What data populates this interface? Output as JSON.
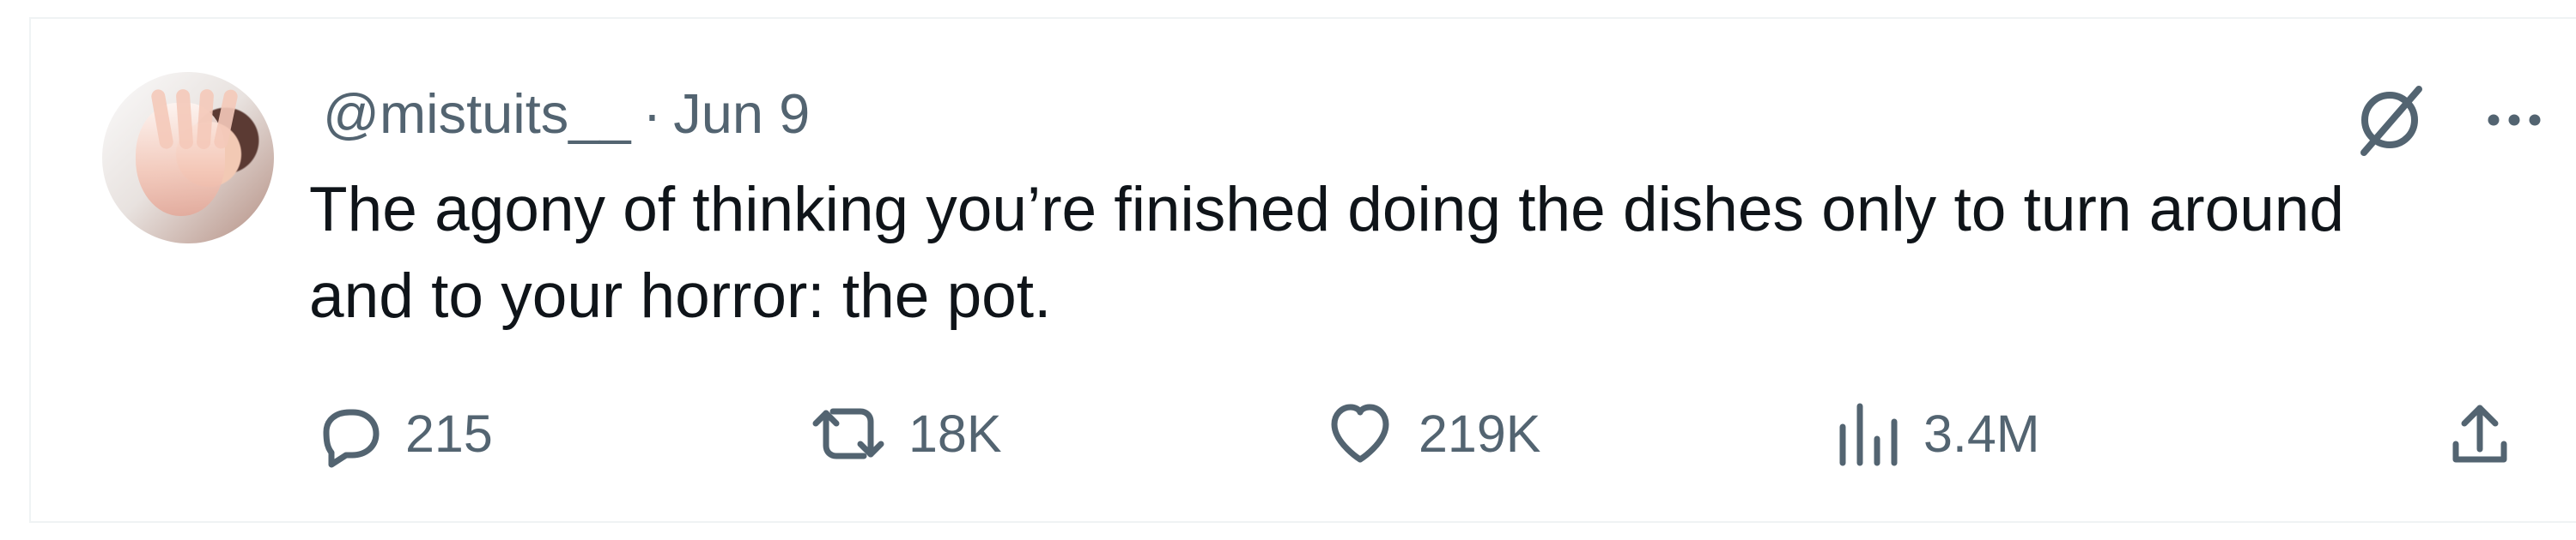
{
  "tweet": {
    "handle": "@mistuits__",
    "separator": "·",
    "date": "Jun 9",
    "text": "The agony of thinking you’re finished doing the dishes only to turn around\nand to your horror: the pot.",
    "avatar": "profile-photo"
  },
  "actions": {
    "reply_count": "215",
    "repost_count": "18K",
    "like_count": "219K",
    "views_count": "3.4M"
  },
  "icons": {
    "top_left": "grok-icon",
    "top_right": "more-icon",
    "reply": "reply-icon",
    "repost": "repost-icon",
    "like": "heart-icon",
    "views": "views-icon",
    "share": "share-icon"
  },
  "colors": {
    "primary_text": "#0f1419",
    "secondary_text": "#536471",
    "border": "#eff3f4",
    "background": "#ffffff"
  }
}
